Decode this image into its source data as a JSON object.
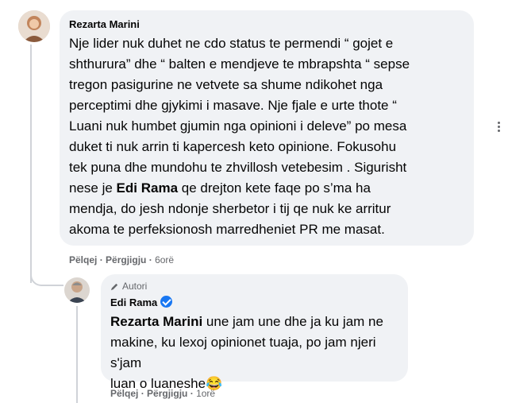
{
  "comment": {
    "author": "Rezarta Marini",
    "lines": [
      "Nje lider nuk duhet ne cdo status te permendi “ gojet e",
      "shthurura” dhe “ balten e mendjeve te mbrapshta “ sepse",
      "tregon pasigurine ne vetvete sa shume ndikohet nga",
      "perceptimi dhe gjykimi i masave. Nje fjale e urte thote “",
      "Luani nuk humbet gjumin nga opinioni i deleve” po mesa",
      "duket ti nuk arrin ti kapercesh keto opinione. Fokusohu",
      "tek puna dhe mundohu te zhvillosh vetebesim . Sigurisht"
    ],
    "line8_pre": "nese je ",
    "line8_mention": "Edi Rama",
    "line8_post": " qe drejton kete faqe po s’ma ha",
    "line9": "mendja, do jesh ndonje sherbetor i tij qe nuk ke arritur",
    "line10": "akoma te perfeksionosh marredheniet PR me masat.",
    "actions": {
      "like": "Pëlqej",
      "sep": "·",
      "reply": "Përgjigju",
      "time": "6orë"
    }
  },
  "reply": {
    "badge": "Autori",
    "author": "Edi Rama",
    "mention": "Rezarta Marini",
    "text_line1": " une jam une dhe ja ku jam ne",
    "line2": "makine, ku lexoj opinionet tuaja, po jam njeri s'jam",
    "line3": "luan o luaneshe😂",
    "actions": {
      "like": "Pëlqej",
      "sep": "·",
      "reply": "Përgjigju",
      "time": "1orë"
    }
  },
  "colors": {
    "bubble": "#f0f2f5",
    "verified": "#1877f2",
    "meta": "#65676b"
  }
}
